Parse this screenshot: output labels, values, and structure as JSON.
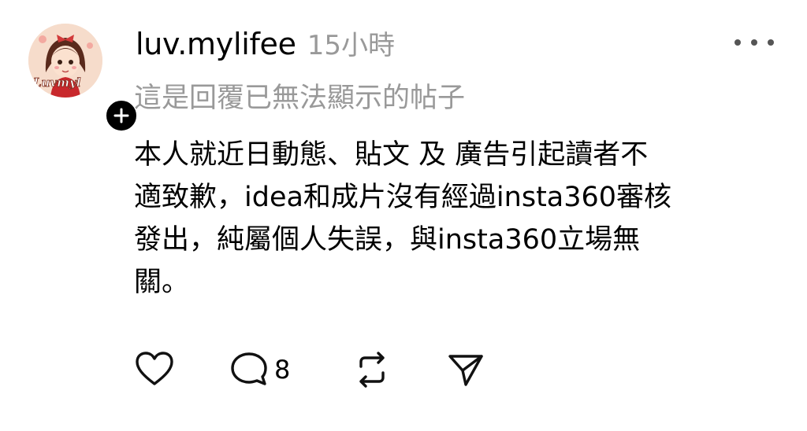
{
  "post": {
    "username": "luv.mylifee",
    "time": "15小時",
    "avatar_text": "Luvmyl",
    "reply_note": "這是回覆已無法顯示的帖子",
    "body_lines": [
      "本人就近日動態、貼文 及 廣告引起讀者不",
      "適致歉，idea和成片沒有經過insta360審核",
      "發出，純屬個人失誤，與insta360立場無",
      "關。"
    ]
  },
  "actions": {
    "like_icon": "heart-icon",
    "comment_icon": "comment-icon",
    "comment_count": "8",
    "repost_icon": "repost-icon",
    "share_icon": "send-icon"
  },
  "colors": {
    "text": "#000000",
    "muted": "#999999",
    "icon": "#111111"
  }
}
